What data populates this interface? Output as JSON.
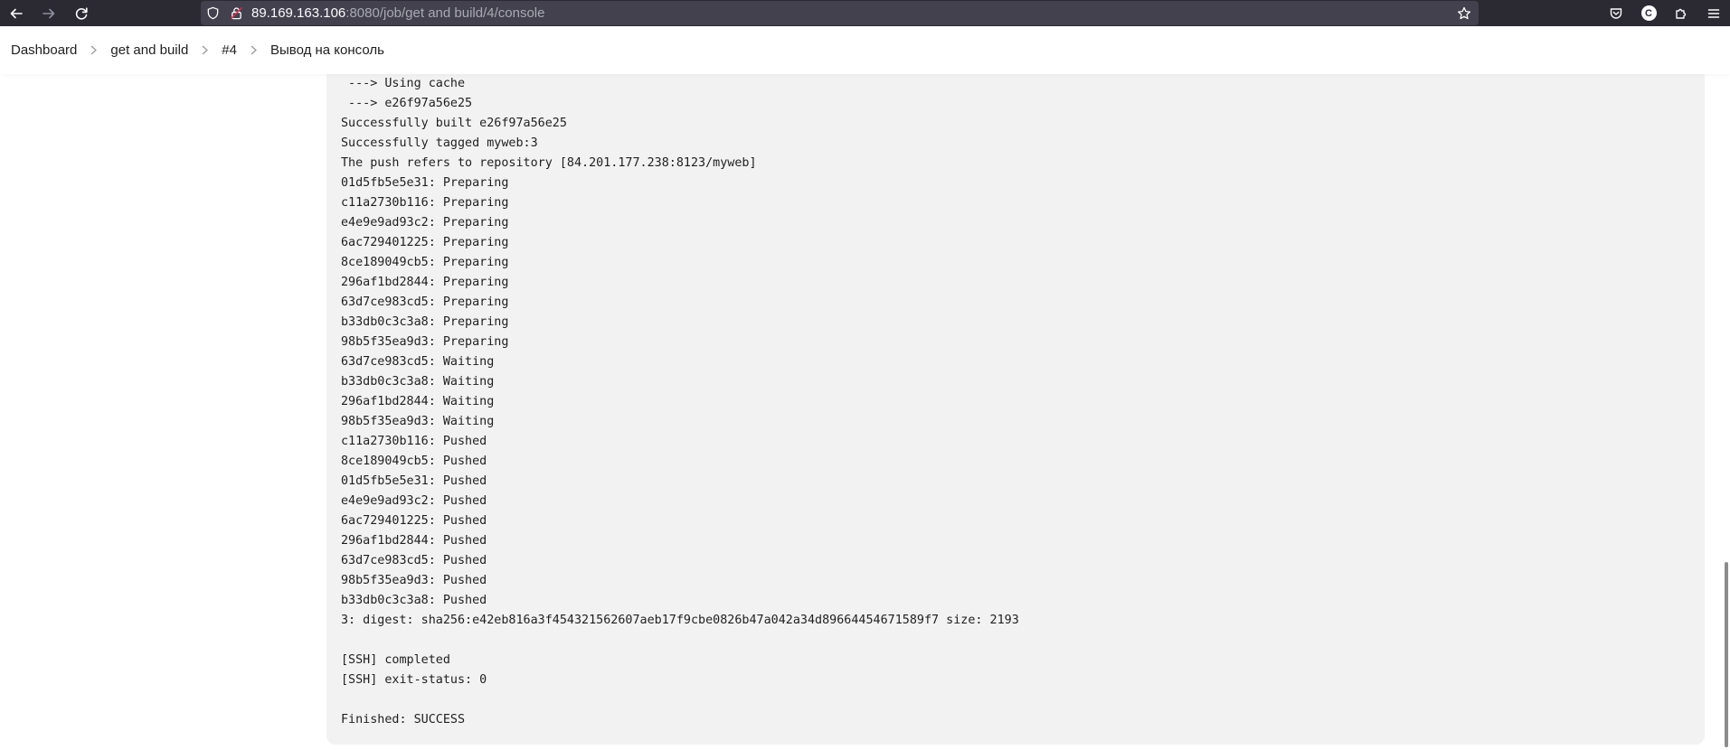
{
  "browser": {
    "url_host": "89.169.163.106",
    "url_path": ":8080/job/get and build/4/console",
    "profile_initial": "C"
  },
  "breadcrumb": {
    "items": [
      {
        "label": "Dashboard"
      },
      {
        "label": "get and build"
      },
      {
        "label": "#4"
      },
      {
        "label": "Вывод на консоль"
      }
    ]
  },
  "console": {
    "lines": [
      " ---> Using cache",
      " ---> e26f97a56e25",
      "Successfully built e26f97a56e25",
      "Successfully tagged myweb:3",
      "The push refers to repository [84.201.177.238:8123/myweb]",
      "01d5fb5e5e31: Preparing",
      "c11a2730b116: Preparing",
      "e4e9e9ad93c2: Preparing",
      "6ac729401225: Preparing",
      "8ce189049cb5: Preparing",
      "296af1bd2844: Preparing",
      "63d7ce983cd5: Preparing",
      "b33db0c3c3a8: Preparing",
      "98b5f35ea9d3: Preparing",
      "63d7ce983cd5: Waiting",
      "b33db0c3c3a8: Waiting",
      "296af1bd2844: Waiting",
      "98b5f35ea9d3: Waiting",
      "c11a2730b116: Pushed",
      "8ce189049cb5: Pushed",
      "01d5fb5e5e31: Pushed",
      "e4e9e9ad93c2: Pushed",
      "6ac729401225: Pushed",
      "296af1bd2844: Pushed",
      "63d7ce983cd5: Pushed",
      "98b5f35ea9d3: Pushed",
      "b33db0c3c3a8: Pushed",
      "3: digest: sha256:e42eb816a3f454321562607aeb17f9cbe0826b47a042a34d89664454671589f7 size: 2193",
      "",
      "[SSH] completed",
      "[SSH] exit-status: 0",
      "",
      "Finished: SUCCESS"
    ]
  }
}
